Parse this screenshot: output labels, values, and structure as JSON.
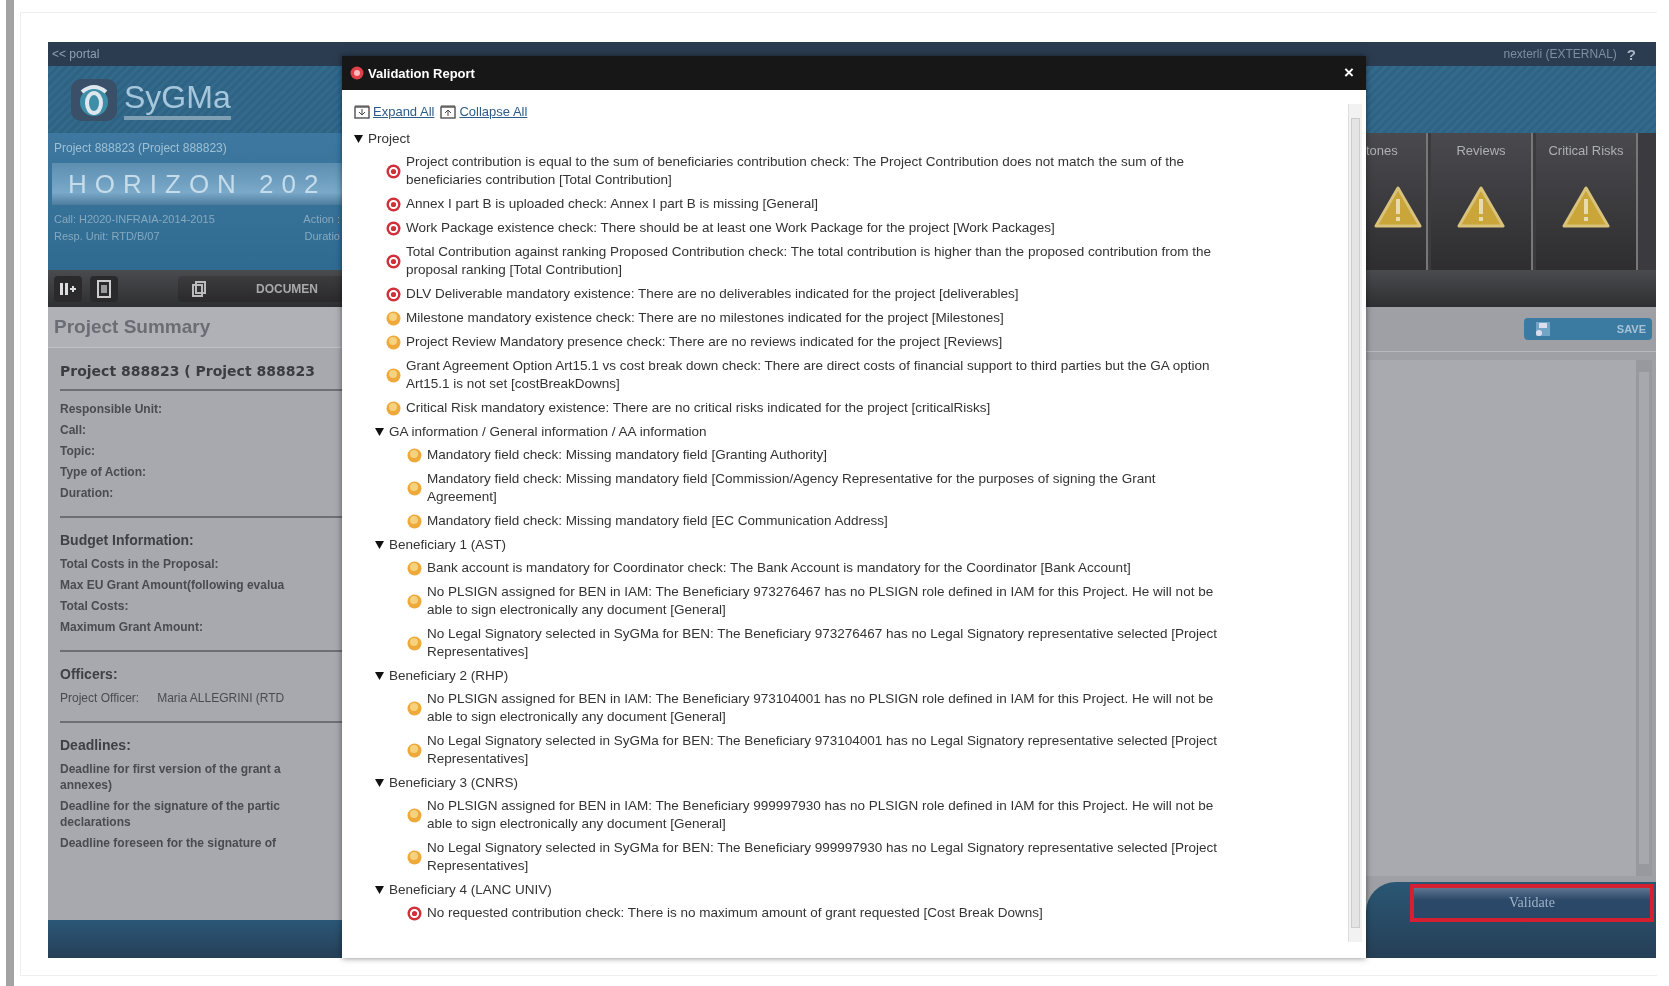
{
  "topbar": {
    "portal_link": "<< portal",
    "user": "nexterli (EXTERNAL)",
    "help": "?"
  },
  "header": {
    "app_name": "SyGMa",
    "project_title": "Project 888823 (Project 888823)",
    "banner": "HORIZON 202",
    "info": [
      [
        "Call: H2020-INFRAIA-2014-2015",
        "Action :"
      ],
      [
        "Resp. Unit: RTD/B/07",
        "Duratio"
      ]
    ]
  },
  "tiles": [
    {
      "label": "tones"
    },
    {
      "label": "Reviews"
    },
    {
      "label": "Critical Risks"
    }
  ],
  "toolbar": {
    "documents_button": "DOCUMEN"
  },
  "summary": {
    "title": "Project Summary",
    "project_heading": "Project 888823 ( Project 888823",
    "sections": [
      {
        "fields": [
          [
            "Responsible Unit:"
          ],
          [
            "Call:"
          ],
          [
            "Topic:"
          ],
          [
            "Type of Action:"
          ],
          [
            "Duration:"
          ]
        ]
      },
      {
        "heading": "Budget Information:",
        "fields": [
          [
            "Total Costs in the Proposal:"
          ],
          [
            "Max EU Grant Amount(following evalua"
          ],
          [
            "Total Costs:"
          ],
          [
            "Maximum Grant Amount:"
          ]
        ]
      },
      {
        "heading": "Officers:",
        "fields": [
          [
            "Project Officer:",
            "Maria ALLEGRINI (RTD"
          ]
        ]
      },
      {
        "heading": "Deadlines:",
        "fields": [
          [
            "Deadline for first version of the grant a",
            "annexes)"
          ],
          [
            "Deadline for the signature of the partic",
            "declarations"
          ],
          [
            "Deadline foreseen for the signature of"
          ]
        ]
      }
    ]
  },
  "right_panel": {
    "save_button": "SAVE",
    "validate_button": "Validate",
    "validate_highlighted": true
  },
  "dialog": {
    "title": "Validation Report",
    "close": "×",
    "actions": [
      "Expand All",
      "Collapse All"
    ],
    "tree": [
      {
        "kind": "group",
        "label": "Project",
        "expanded": true,
        "children": [
          {
            "kind": "error",
            "text": "Project contribution is equal to the sum of beneficiaries contribution check: The Project Contribution does not match the sum of the beneficiaries contribution [Total Contribution]"
          },
          {
            "kind": "error",
            "text": "Annex I part B is uploaded check: Annex I part B is missing [General]"
          },
          {
            "kind": "error",
            "text": "Work Package existence check: There should be at least one Work Package for the project [Work Packages]"
          },
          {
            "kind": "error",
            "text": "Total Contribution against ranking Proposed Contribution check: The total contribution is higher than the proposed contribution from the proposal ranking [Total Contribution]"
          },
          {
            "kind": "error",
            "text": "DLV Deliverable mandatory existence: There are no deliverables indicated for the project [deliverables]"
          },
          {
            "kind": "warning",
            "text": "Milestone mandatory existence check: There are no milestones indicated for the project [Milestones]"
          },
          {
            "kind": "warning",
            "text": "Project Review Mandatory presence check: There are no reviews indicated for the project [Reviews]"
          },
          {
            "kind": "warning",
            "text": "Grant Agreement Option Art15.1 vs cost break down check: There are direct costs of financial support to third parties but the GA option Art15.1 is not set [costBreakDowns]"
          },
          {
            "kind": "warning",
            "text": "Critical Risk mandatory existence: There are no critical risks indicated for the project [criticalRisks]"
          },
          {
            "kind": "group",
            "label": "GA information / General information / AA information",
            "expanded": true,
            "children": [
              {
                "kind": "warning",
                "text": "Mandatory field check: Missing mandatory field [Granting Authority]"
              },
              {
                "kind": "warning",
                "text": "Mandatory field check: Missing mandatory field [Commission/Agency Representative for the purposes of signing the Grant Agreement]"
              },
              {
                "kind": "warning",
                "text": "Mandatory field check: Missing mandatory field [EC Communication Address]"
              }
            ]
          },
          {
            "kind": "group",
            "label": "Beneficiary 1 (AST)",
            "expanded": true,
            "children": [
              {
                "kind": "warning",
                "text": "Bank account is mandatory for Coordinator check: The Bank Account is mandatory for the Coordinator [Bank Account]"
              },
              {
                "kind": "warning",
                "text": "No PLSIGN assigned for BEN in IAM: The Beneficiary 973276467 has no PLSIGN role defined in IAM for this Project. He will not be able to sign electronically any document [General]"
              },
              {
                "kind": "warning",
                "text": "No Legal Signatory selected in SyGMa for BEN: The Beneficiary 973276467 has no Legal Signatory representative selected [Project Representatives]"
              }
            ]
          },
          {
            "kind": "group",
            "label": "Beneficiary 2 (RHP)",
            "expanded": true,
            "children": [
              {
                "kind": "warning",
                "text": "No PLSIGN assigned for BEN in IAM: The Beneficiary 973104001 has no PLSIGN role defined in IAM for this Project. He will not be able to sign electronically any document [General]"
              },
              {
                "kind": "warning",
                "text": "No Legal Signatory selected in SyGMa for BEN: The Beneficiary 973104001 has no Legal Signatory representative selected [Project Representatives]"
              }
            ]
          },
          {
            "kind": "group",
            "label": "Beneficiary 3 (CNRS)",
            "expanded": true,
            "children": [
              {
                "kind": "warning",
                "text": "No PLSIGN assigned for BEN in IAM: The Beneficiary 999997930 has no PLSIGN role defined in IAM for this Project. He will not be able to sign electronically any document [General]"
              },
              {
                "kind": "warning",
                "text": "No Legal Signatory selected in SyGMa for BEN: The Beneficiary 999997930 has no Legal Signatory representative selected [Project Representatives]"
              }
            ]
          },
          {
            "kind": "group",
            "label": "Beneficiary 4 (LANC UNIV)",
            "expanded": true,
            "children": [
              {
                "kind": "error",
                "text": "No requested contribution check: There is no maximum amount of grant requested [Cost Break Downs]"
              }
            ]
          }
        ]
      }
    ]
  }
}
